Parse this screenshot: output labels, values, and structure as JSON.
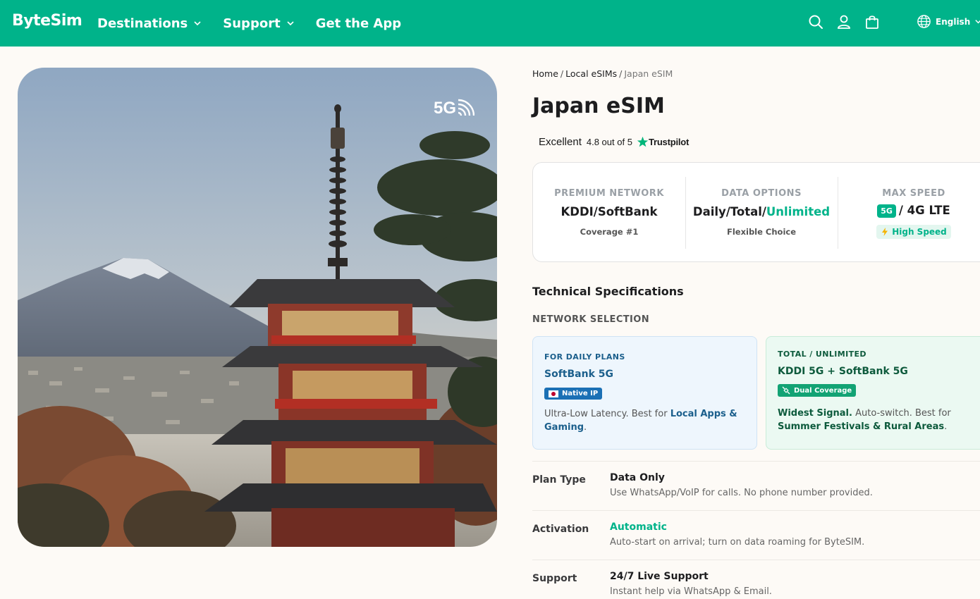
{
  "header": {
    "logo": "ByteSim",
    "nav": [
      {
        "label": "Destinations",
        "has_dropdown": true
      },
      {
        "label": "Support",
        "has_dropdown": true
      },
      {
        "label": "Get the App",
        "has_dropdown": false
      }
    ],
    "icons": [
      "search-icon",
      "account-icon",
      "cart-icon"
    ],
    "language": "English",
    "bg_color": "#00b38a"
  },
  "hero": {
    "badge": "5G"
  },
  "breadcrumb": {
    "items": [
      "Home",
      "Local eSIMs"
    ],
    "current": "Japan eSIM"
  },
  "product": {
    "title": "Japan eSIM"
  },
  "trustpilot": {
    "rating_word": "Excellent",
    "score_text": "4.8 out of 5",
    "brand": "Trustpilot"
  },
  "stats": [
    {
      "label": "PREMIUM NETWORK",
      "value": "KDDI/SoftBank",
      "sub": "Coverage #1"
    },
    {
      "label": "DATA OPTIONS",
      "value_prefix": "Daily/Total/",
      "value_highlight": "Unlimited",
      "sub": "Flexible Choice"
    },
    {
      "label": "MAX SPEED",
      "value_tag": "5G",
      "value_rest": "/ 4G LTE",
      "sub": "High Speed"
    }
  ],
  "tech": {
    "heading": "Technical Specifications",
    "network_heading": "NETWORK SELECTION",
    "cards": [
      {
        "kicker": "FOR DAILY PLANS",
        "name": "SoftBank 5G",
        "pill": "Native IP",
        "desc_prefix": "Ultra-Low Latency. Best for ",
        "desc_bold": "Local Apps & Gaming",
        "desc_suffix": "."
      },
      {
        "kicker": "TOTAL / UNLIMITED",
        "name": "KDDI 5G + SoftBank 5G",
        "pill": "Dual Coverage",
        "desc_bold1": "Widest Signal.",
        "desc_mid": " Auto-switch. Best for ",
        "desc_bold2": "Summer Festivals & Rural Areas",
        "desc_suffix": "."
      }
    ]
  },
  "specs": [
    {
      "key": "Plan Type",
      "value": "Data Only",
      "sub": "Use WhatsApp/VoIP for calls. No phone number provided."
    },
    {
      "key": "Activation",
      "value": "Automatic",
      "sub": "Auto-start on arrival; turn on data roaming for ByteSIM."
    },
    {
      "key": "Support",
      "value": "24/7 Live Support",
      "sub": "Instant help via WhatsApp & Email."
    }
  ],
  "colors": {
    "brand": "#00b38a",
    "page_bg": "#fdfaf6",
    "blue_card": "#eef6fd",
    "green_card": "#ebf9f2"
  }
}
